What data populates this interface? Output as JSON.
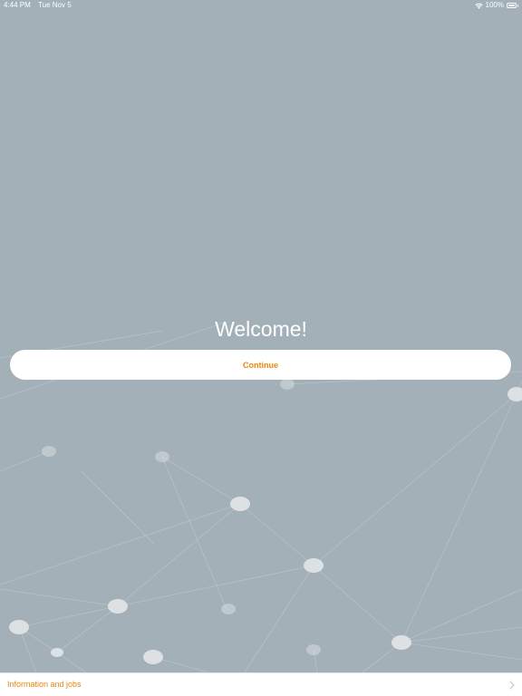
{
  "status_bar": {
    "time": "4:44 PM",
    "date": "Tue Nov 5",
    "battery": "100%"
  },
  "welcome": {
    "title": "Welcome!",
    "continue_label": "Continue"
  },
  "footer": {
    "link_label": "Information and jobs"
  },
  "colors": {
    "background": "#a3b0b8",
    "accent": "#e8870f",
    "node": "#d9dde0"
  },
  "icons": [
    "wifi-icon",
    "battery-icon",
    "chevron-right-icon"
  ]
}
